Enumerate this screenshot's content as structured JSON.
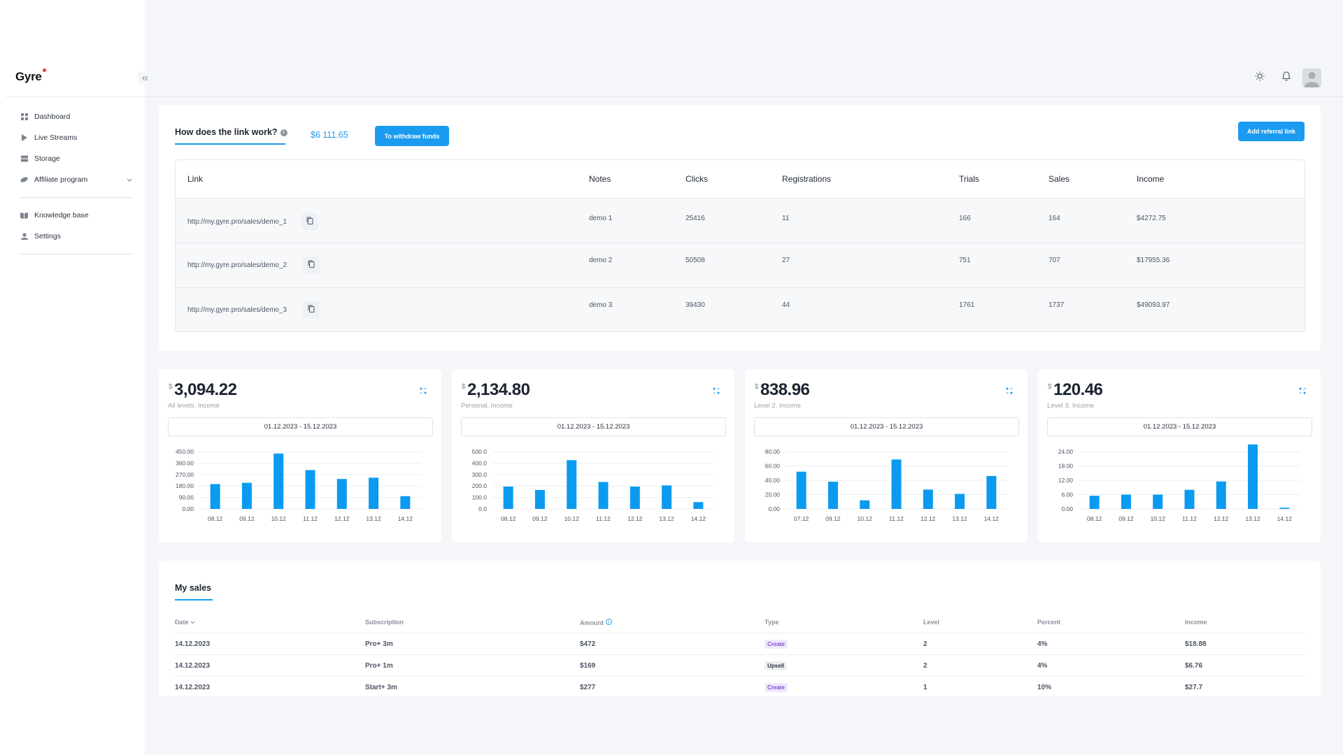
{
  "app": {
    "name": "Gyre"
  },
  "sidebar": {
    "items": [
      {
        "label": "Dashboard",
        "icon": "dashboard-icon"
      },
      {
        "label": "Live Streams",
        "icon": "play-icon"
      },
      {
        "label": "Storage",
        "icon": "storage-icon"
      },
      {
        "label": "Affiliate program",
        "icon": "affiliate-icon"
      },
      {
        "label": "Knowledge base",
        "icon": "book-icon"
      },
      {
        "label": "Settings",
        "icon": "user-icon"
      }
    ]
  },
  "links": {
    "tab_title": "How does the link work?",
    "balance": "$6 111.65",
    "withdraw_label": "To withdraw funds",
    "add_label": "Add referral link",
    "columns": [
      "Link",
      "Notes",
      "Clicks",
      "Registrations",
      "Trials",
      "Sales",
      "Income"
    ],
    "rows": [
      {
        "link": "http://my.gyre.pro/sales/demo_1",
        "notes": "demo 1",
        "clicks": "25416",
        "registrations": "11",
        "trials": "166",
        "sales": "164",
        "income": "$4272.75"
      },
      {
        "link": "http://my.gyre.pro/sales/demo_2",
        "notes": "demo 2",
        "clicks": "50508",
        "registrations": "27",
        "trials": "751",
        "sales": "707",
        "income": "$17955.36"
      },
      {
        "link": "http://my.gyre.pro/sales/demo_3",
        "notes": "demo 3",
        "clicks": "39430",
        "registrations": "44",
        "trials": "1761",
        "sales": "1737",
        "income": "$49093.97"
      }
    ]
  },
  "stats": [
    {
      "currency": "$",
      "value": "3,094.22",
      "label": "All levels. Income",
      "range": "01.12.2023 - 15.12.2023"
    },
    {
      "currency": "$",
      "value": "2,134.80",
      "label": "Personal. Income",
      "range": "01.12.2023 - 15.12.2023"
    },
    {
      "currency": "$",
      "value": "838.96",
      "label": "Level 2. Income",
      "range": "01.12.2023 - 15.12.2023"
    },
    {
      "currency": "$",
      "value": "120.46",
      "label": "Level 3. Income",
      "range": "01.12.2023 - 15.12.2023"
    }
  ],
  "chart_data": [
    {
      "type": "bar",
      "categories": [
        "08.12",
        "09.12",
        "10.12",
        "11.12",
        "12.12",
        "13.12",
        "14.12"
      ],
      "values": [
        195,
        205,
        435,
        305,
        235,
        245,
        100
      ],
      "ylim": [
        0,
        450
      ],
      "yticks": [
        "0.00",
        "90.00",
        "180.00",
        "270.00",
        "360.00",
        "450.00"
      ],
      "color": "#0a9bf0"
    },
    {
      "type": "bar",
      "categories": [
        "08.12",
        "09.12",
        "10.12",
        "11.12",
        "12.12",
        "13.12",
        "14.12"
      ],
      "values": [
        195,
        165,
        425,
        235,
        195,
        205,
        60
      ],
      "ylim": [
        0,
        500
      ],
      "yticks": [
        "0.0",
        "100.0",
        "200.0",
        "300.0",
        "400.0",
        "500.0"
      ],
      "color": "#0a9bf0"
    },
    {
      "type": "bar",
      "categories": [
        "07.12",
        "09.12",
        "10.12",
        "11.12",
        "12.12",
        "13.12",
        "14.12"
      ],
      "values": [
        52,
        38,
        12,
        69,
        27,
        21,
        46
      ],
      "ylim": [
        0,
        80
      ],
      "yticks": [
        "0.00",
        "20.00",
        "40.00",
        "60.00",
        "80.00"
      ],
      "color": "#0a9bf0"
    },
    {
      "type": "bar",
      "categories": [
        "08.12",
        "09.12",
        "10.12",
        "11.12",
        "12.12",
        "13.12",
        "14.12"
      ],
      "values": [
        5.5,
        6,
        6,
        8,
        11.5,
        27,
        0.5
      ],
      "ylim": [
        0,
        24
      ],
      "yticks": [
        "0.00",
        "6.00",
        "12.00",
        "18.00",
        "24.00"
      ],
      "color": "#0a9bf0"
    }
  ],
  "sales": {
    "title": "My sales",
    "columns": [
      "Date",
      "Subscription",
      "Amount",
      "Type",
      "Level",
      "Percent",
      "Income"
    ],
    "rows": [
      {
        "date": "14.12.2023",
        "subscription": "Pro+ 3m",
        "amount": "$472",
        "type": "Create",
        "level": "2",
        "percent": "4%",
        "income": "$18.88"
      },
      {
        "date": "14.12.2023",
        "subscription": "Pro+ 1m",
        "amount": "$169",
        "type": "Upsell",
        "level": "2",
        "percent": "4%",
        "income": "$6.76"
      },
      {
        "date": "14.12.2023",
        "subscription": "Start+ 3m",
        "amount": "$277",
        "type": "Create",
        "level": "1",
        "percent": "10%",
        "income": "$27.7"
      }
    ]
  }
}
